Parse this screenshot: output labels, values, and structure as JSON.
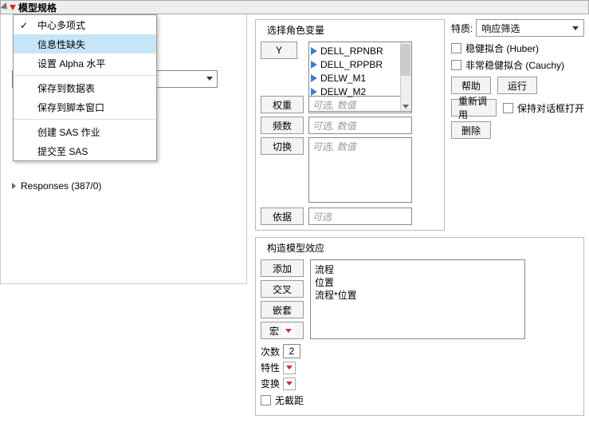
{
  "panel": {
    "title": "模型规格"
  },
  "menu": {
    "items": [
      {
        "label": "中心多项式",
        "checked": true
      },
      {
        "label": "信息性缺失",
        "highlight": true
      },
      {
        "label": "设置 Alpha 水平"
      },
      {
        "label": "保存到数据表"
      },
      {
        "label": "保存到脚本窗口"
      },
      {
        "label": "创建 SAS 作业"
      },
      {
        "label": "提交至 SAS"
      }
    ]
  },
  "tree": {
    "responses": "Responses (387/0)"
  },
  "roles": {
    "section_title": "选择角色变量",
    "y": "Y",
    "vars": [
      "DELL_RPNBR",
      "DELL_RPPBR",
      "DELW_M1",
      "DELW_M2"
    ],
    "weight": "权重",
    "freq": "频数",
    "switch": "切换",
    "by": "依据",
    "optional_num": "可选, 数值",
    "optional": "可选"
  },
  "traits": {
    "label": "特质:",
    "dd_value": "响应筛选",
    "chk1": "稳健拟合 (Huber)",
    "chk2": "非常稳健拟合 (Cauchy)",
    "help": "帮助",
    "run": "运行",
    "recall": "重新调用",
    "keep_open": "保持对话框打开",
    "delete": "删除"
  },
  "construct": {
    "title": "构造模型效应",
    "add": "添加",
    "cross": "交叉",
    "nest": "嵌套",
    "macro": "宏",
    "effects": [
      "流程",
      "位置",
      "流程*位置"
    ],
    "degree_lbl": "次数",
    "degree_val": "2",
    "prop_lbl": "特性",
    "transform_lbl": "变换",
    "no_intercept": "无截距"
  }
}
